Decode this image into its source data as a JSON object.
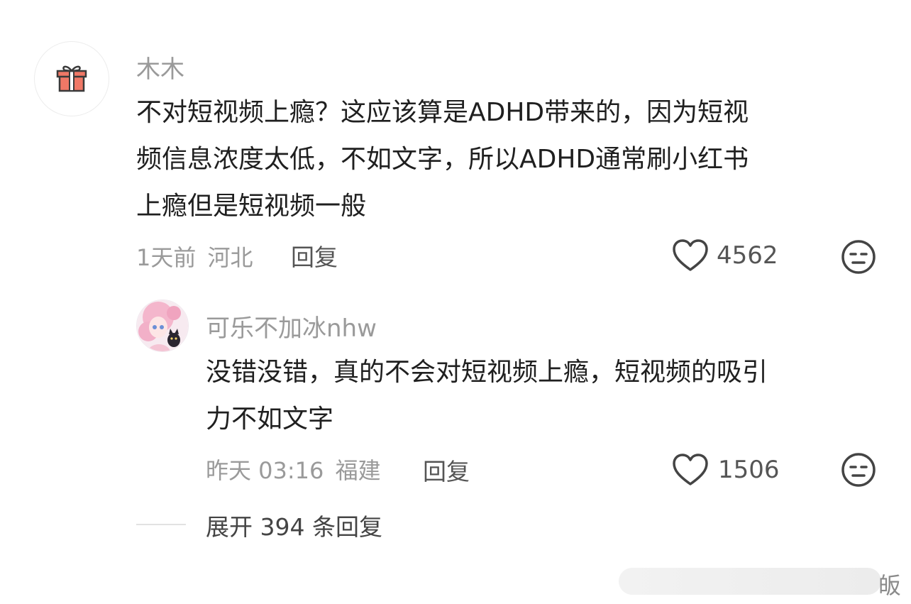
{
  "comments": [
    {
      "username": "木木",
      "avatar_icon": "gift-icon",
      "content_lines": [
        "不对短视频上瘾？这应该算是ADHD带来的，因为短视",
        "频信息浓度太低，不如文字，所以ADHD通常刷小红书",
        "上瘾但是短视频一般"
      ],
      "time": "1天前",
      "location": "河北",
      "reply_label": "回复",
      "likes": "4562"
    }
  ],
  "replies": [
    {
      "username": "可乐不加冰nhw",
      "avatar_icon": "anime-girl-avatar",
      "content_lines": [
        "没错没错，真的不会对短视频上瘾，短视频的吸引",
        "力不如文字"
      ],
      "time": "昨天 03:16",
      "location": "福建",
      "reply_label": "回复",
      "likes": "1506"
    }
  ],
  "expand": {
    "label": "展开 394 条回复"
  },
  "watermark": {
    "char": "皈"
  },
  "colors": {
    "username": "#9a9a9a",
    "text": "#1f1f1f",
    "meta": "#9a9a9a",
    "icon_stroke": "#444444"
  }
}
